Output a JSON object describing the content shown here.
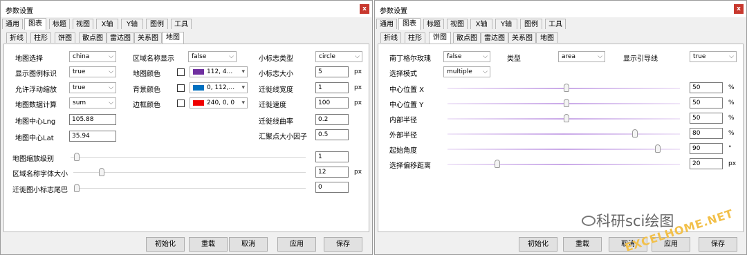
{
  "left": {
    "title": "参数设置",
    "close_label": "x",
    "tabs": [
      "通用",
      "图表",
      "标题",
      "视图",
      "X轴",
      "Y轴",
      "图例",
      "工具"
    ],
    "subtabs": [
      "折线",
      "柱形",
      "饼图",
      "散点图",
      "雷达图",
      "关系图",
      "地图"
    ],
    "map_select_label": "地图选择",
    "map_select_value": "china",
    "show_legend_label": "显示图例标识",
    "show_legend_value": "true",
    "allow_zoom_label": "允许浮动缩放",
    "allow_zoom_value": "true",
    "map_calc_label": "地图数据计算",
    "map_calc_value": "sum",
    "center_lng_label": "地图中心Lng",
    "center_lng_value": "105.88",
    "center_lat_label": "地图中心Lat",
    "center_lat_value": "35.94",
    "region_name_label": "区域名称显示",
    "region_name_value": "false",
    "map_color_label": "地图颜色",
    "map_color_value": "112, 4...",
    "bg_color_label": "背景颜色",
    "bg_color_value": "0, 112,...",
    "border_color_label": "边框颜色",
    "border_color_value": "240, 0, 0",
    "marker_type_label": "小标志类型",
    "marker_type_value": "circle",
    "marker_size_label": "小标志大小",
    "marker_size_value": "5",
    "migration_width_label": "迁徙线宽度",
    "migration_width_value": "1",
    "migration_speed_label": "迁徙速度",
    "migration_speed_value": "100",
    "migration_curve_label": "迁徙线曲率",
    "migration_curve_value": "0.2",
    "gather_factor_label": "汇聚点大小因子",
    "gather_factor_value": "0.5",
    "zoom_level_label": "地图缩放级别",
    "zoom_level_value": "1",
    "region_font_label": "区域名称字体大小",
    "region_font_value": "12",
    "marker_tail_label": "迁徙图小标志尾巴",
    "marker_tail_value": "0",
    "px": "px",
    "buttons": {
      "init": "初始化",
      "reload": "重载",
      "cancel": "取消",
      "apply": "应用",
      "save": "保存"
    },
    "colors": {
      "map": "#7030a0",
      "bg": "#0070c0",
      "border": "#f00000"
    }
  },
  "right": {
    "title": "参数设置",
    "close_label": "x",
    "tabs": [
      "通用",
      "图表",
      "标题",
      "视图",
      "X轴",
      "Y轴",
      "图例",
      "工具"
    ],
    "subtabs": [
      "折线",
      "柱形",
      "饼图",
      "散点图",
      "雷达图",
      "关系图",
      "地图"
    ],
    "nightingale_label": "南丁格尔玫瑰",
    "nightingale_value": "false",
    "type_label": "类型",
    "type_value": "area",
    "show_guide_label": "显示引导线",
    "show_guide_value": "true",
    "select_mode_label": "选择模式",
    "select_mode_value": "multiple",
    "center_x_label": "中心位置 X",
    "center_x_value": "50",
    "center_x_unit": "%",
    "center_y_label": "中心位置 Y",
    "center_y_value": "50",
    "center_y_unit": "%",
    "inner_radius_label": "内部半径",
    "inner_radius_value": "50",
    "inner_radius_unit": "%",
    "outer_radius_label": "外部半径",
    "outer_radius_value": "80",
    "outer_radius_unit": "%",
    "start_angle_label": "起始角度",
    "start_angle_value": "90",
    "start_angle_unit": "°",
    "select_offset_label": "选择偏移距离",
    "select_offset_value": "20",
    "select_offset_unit": "px",
    "buttons": {
      "init": "初始化",
      "reload": "重载",
      "cancel": "取消",
      "apply": "应用",
      "save": "保存"
    }
  },
  "watermark": {
    "text": "科研sci绘图",
    "site": "EXCELHOME.NET"
  }
}
